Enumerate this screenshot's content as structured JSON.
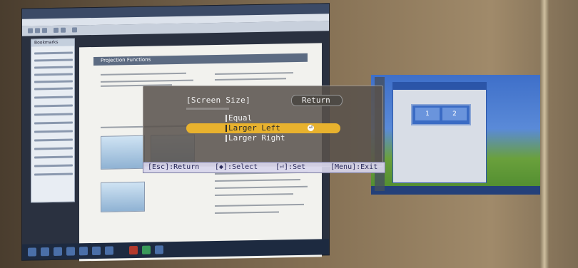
{
  "background_window": {
    "title": "Projection Functions",
    "nav_label": "Bookmarks"
  },
  "osd": {
    "title": "[Screen Size]",
    "return_label": "Return",
    "options": [
      {
        "label": "Equal",
        "selected": false
      },
      {
        "label": "Larger Left",
        "selected": true
      },
      {
        "label": "Larger Right",
        "selected": false
      }
    ],
    "footer": {
      "esc": "[Esc]:Return",
      "select": "[◆]:Select",
      "set": "[⏎]:Set",
      "menu": "[Menu]:Exit"
    }
  },
  "right_window": {
    "monitor_1": "1",
    "monitor_2": "2"
  },
  "colors": {
    "osd_highlight": "#e8b22e",
    "osd_background": "#58524c",
    "footer_background": "#d8d6ec"
  }
}
